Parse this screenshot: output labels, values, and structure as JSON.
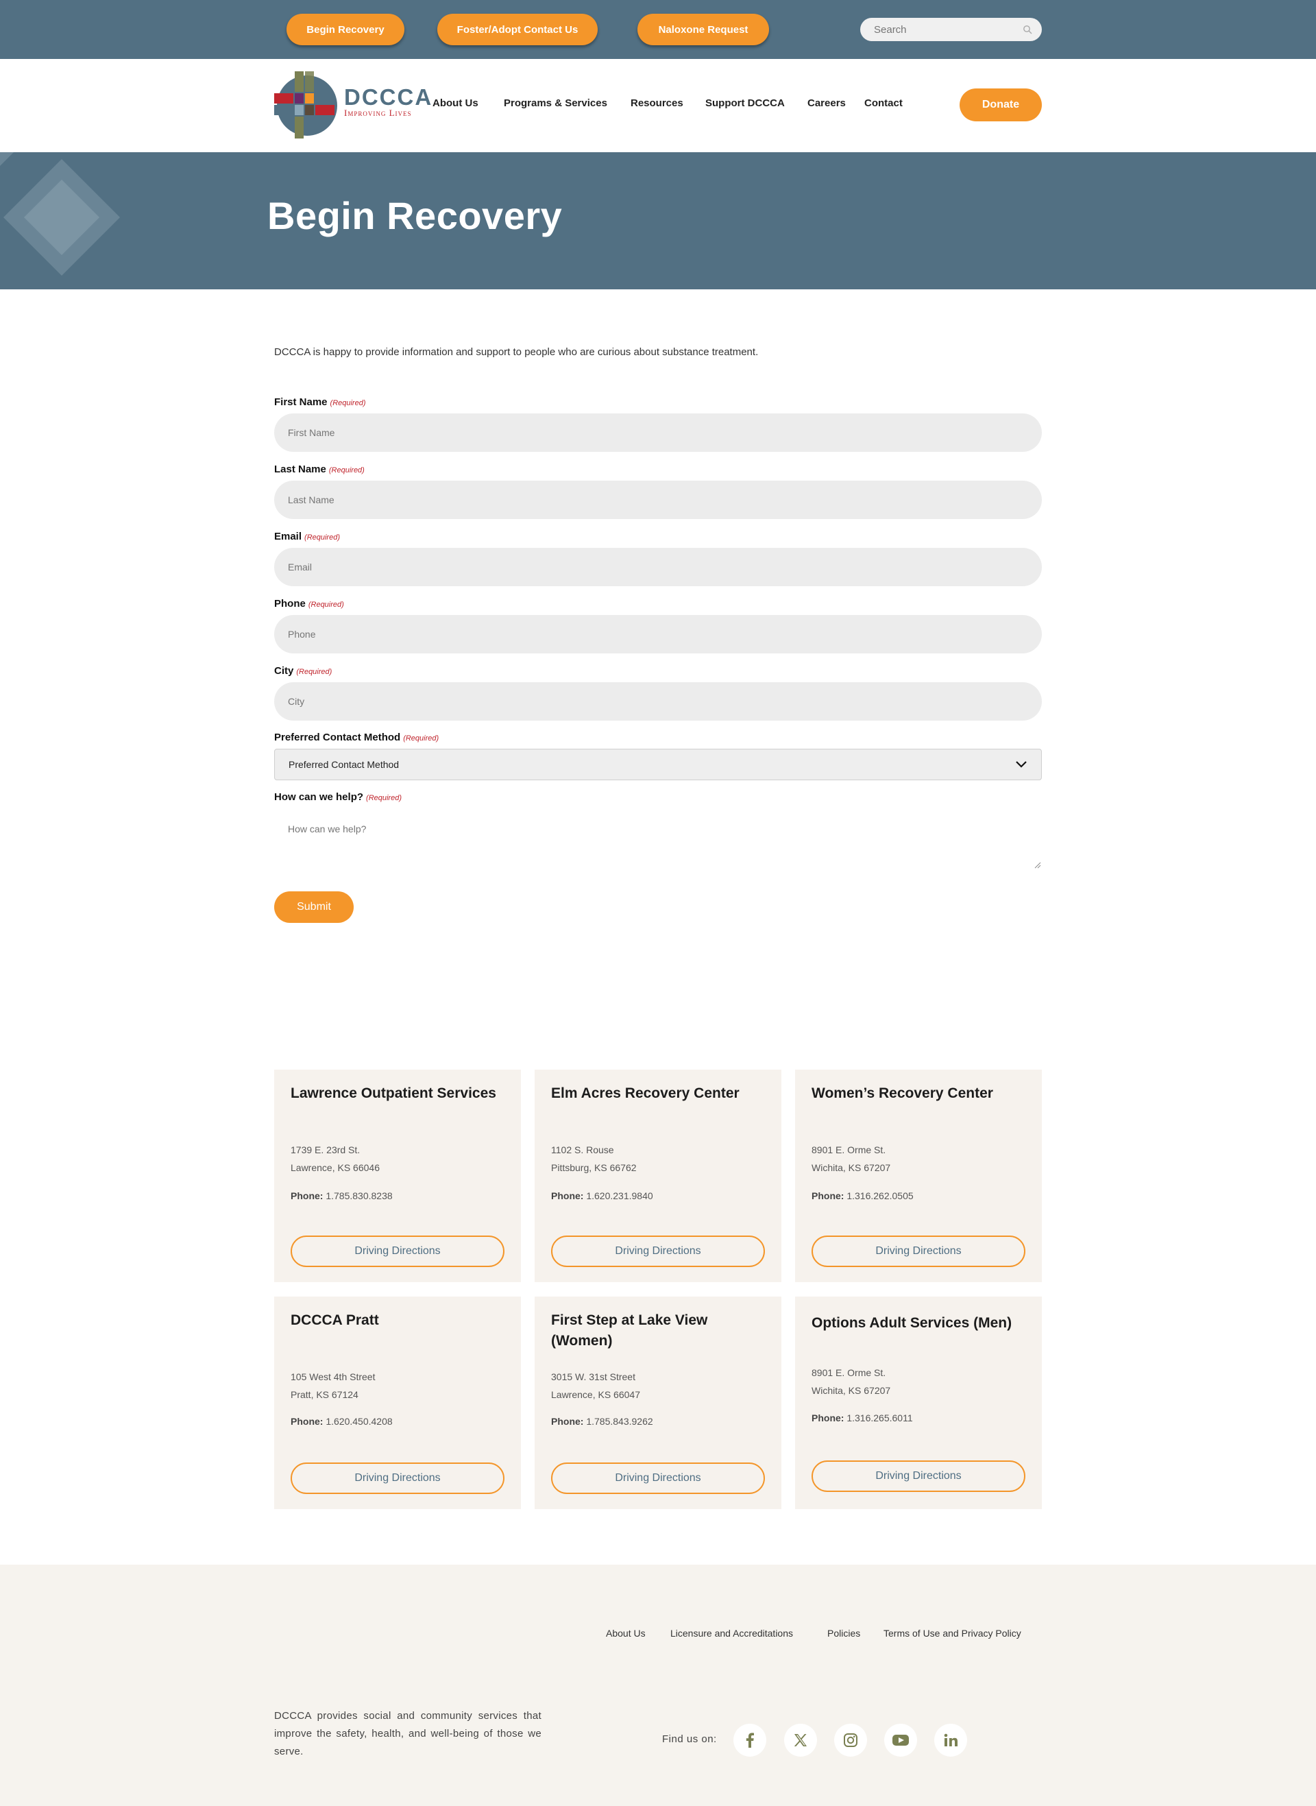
{
  "topbar": {
    "buttons": [
      "Begin Recovery",
      "Foster/Adopt Contact Us",
      "Naloxone Request"
    ],
    "search_placeholder": "Search"
  },
  "header": {
    "logo_name": "DCCCA",
    "logo_tagline": "Improving Lives",
    "nav": [
      "About Us",
      "Programs & Services",
      "Resources",
      "Support DCCCA",
      "Careers",
      "Contact"
    ],
    "donate": "Donate"
  },
  "hero": {
    "title": "Begin Recovery"
  },
  "form": {
    "intro": "DCCCA is happy to provide information and support to people who are curious about substance treatment.",
    "required_text": "(Required)",
    "fields": [
      {
        "label": "First Name",
        "placeholder": "First Name"
      },
      {
        "label": "Last Name",
        "placeholder": "Last Name"
      },
      {
        "label": "Email",
        "placeholder": "Email"
      },
      {
        "label": "Phone",
        "placeholder": "Phone"
      },
      {
        "label": "City",
        "placeholder": "City"
      }
    ],
    "contact_method": {
      "label": "Preferred Contact Method",
      "selected": "Preferred Contact Method"
    },
    "help": {
      "label": "How can we help?",
      "placeholder": "How can we help?"
    },
    "submit": "Submit"
  },
  "locations": [
    {
      "name": "Lawrence Outpatient Services",
      "addr1": "1739 E. 23rd St.",
      "addr2": "Lawrence, KS 66046",
      "phone_label": "Phone:",
      "phone": "1.785.830.8238",
      "button": "Driving Directions"
    },
    {
      "name": "Elm Acres Recovery Center",
      "addr1": "1102 S. Rouse",
      "addr2": "Pittsburg, KS 66762",
      "phone_label": "Phone:",
      "phone": "1.620.231.9840",
      "button": "Driving Directions"
    },
    {
      "name": "Women’s Recovery Center",
      "addr1": "8901 E. Orme St.",
      "addr2": "Wichita, KS 67207",
      "phone_label": "Phone:",
      "phone": "1.316.262.0505",
      "button": "Driving Directions"
    },
    {
      "name": "DCCCA Pratt",
      "addr1": "105 West 4th Street",
      "addr2": "Pratt, KS 67124",
      "phone_label": "Phone:",
      "phone": "1.620.450.4208",
      "button": "Driving Directions"
    },
    {
      "name": "First Step at Lake View (Women)",
      "addr1": "3015 W. 31st Street",
      "addr2": "Lawrence, KS 66047",
      "phone_label": "Phone:",
      "phone": "1.785.843.9262",
      "button": "Driving Directions"
    },
    {
      "name": "Options Adult Services (Men)",
      "addr1": "8901 E. Orme St.",
      "addr2": "Wichita, KS 67207",
      "phone_label": "Phone:",
      "phone": "1.316.265.6011",
      "button": "Driving Directions"
    }
  ],
  "footer": {
    "links": [
      "About Us",
      "Licensure and Accreditations",
      "Policies",
      "Terms of Use and Privacy Policy"
    ],
    "description": "DCCCA provides social and community services that improve the safety, health, and well-being of those we serve.",
    "find_us": "Find us on:",
    "social_icons": [
      "facebook-icon",
      "x-icon",
      "instagram-icon",
      "youtube-icon",
      "linkedin-icon"
    ]
  },
  "colors": {
    "brand_blue": "#527083",
    "accent_orange": "#f4962a",
    "required_red": "#c0252d",
    "card_bg": "#f6f2ed",
    "social_olive": "#7a8052"
  }
}
